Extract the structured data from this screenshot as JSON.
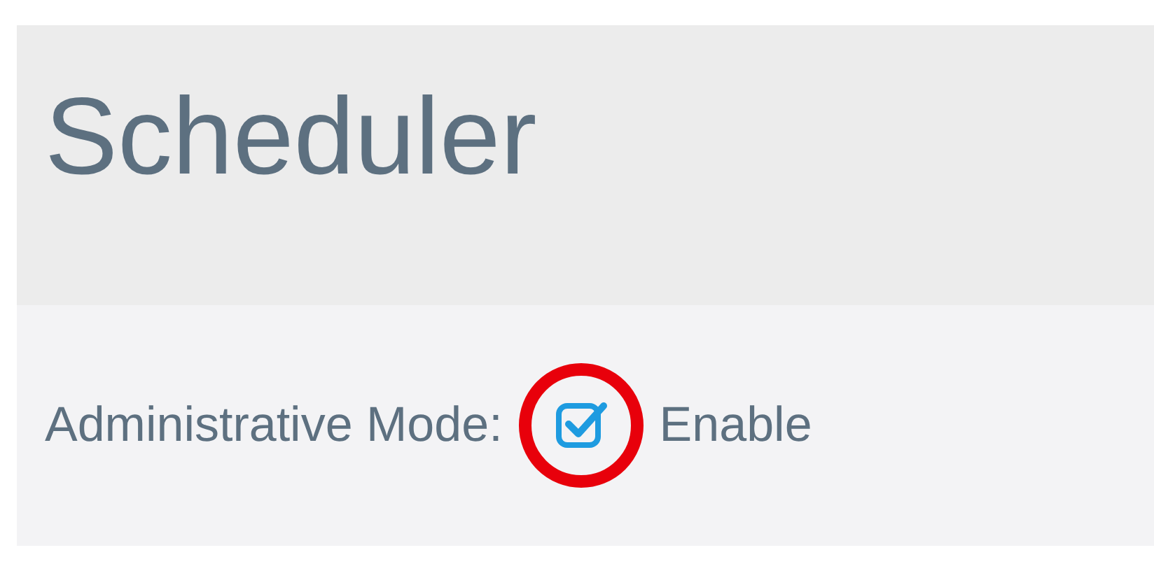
{
  "page": {
    "title": "Scheduler"
  },
  "settings": [
    {
      "label": "Administrative Mode:",
      "option": "Enable",
      "checked": true,
      "highlighted": true
    }
  ]
}
